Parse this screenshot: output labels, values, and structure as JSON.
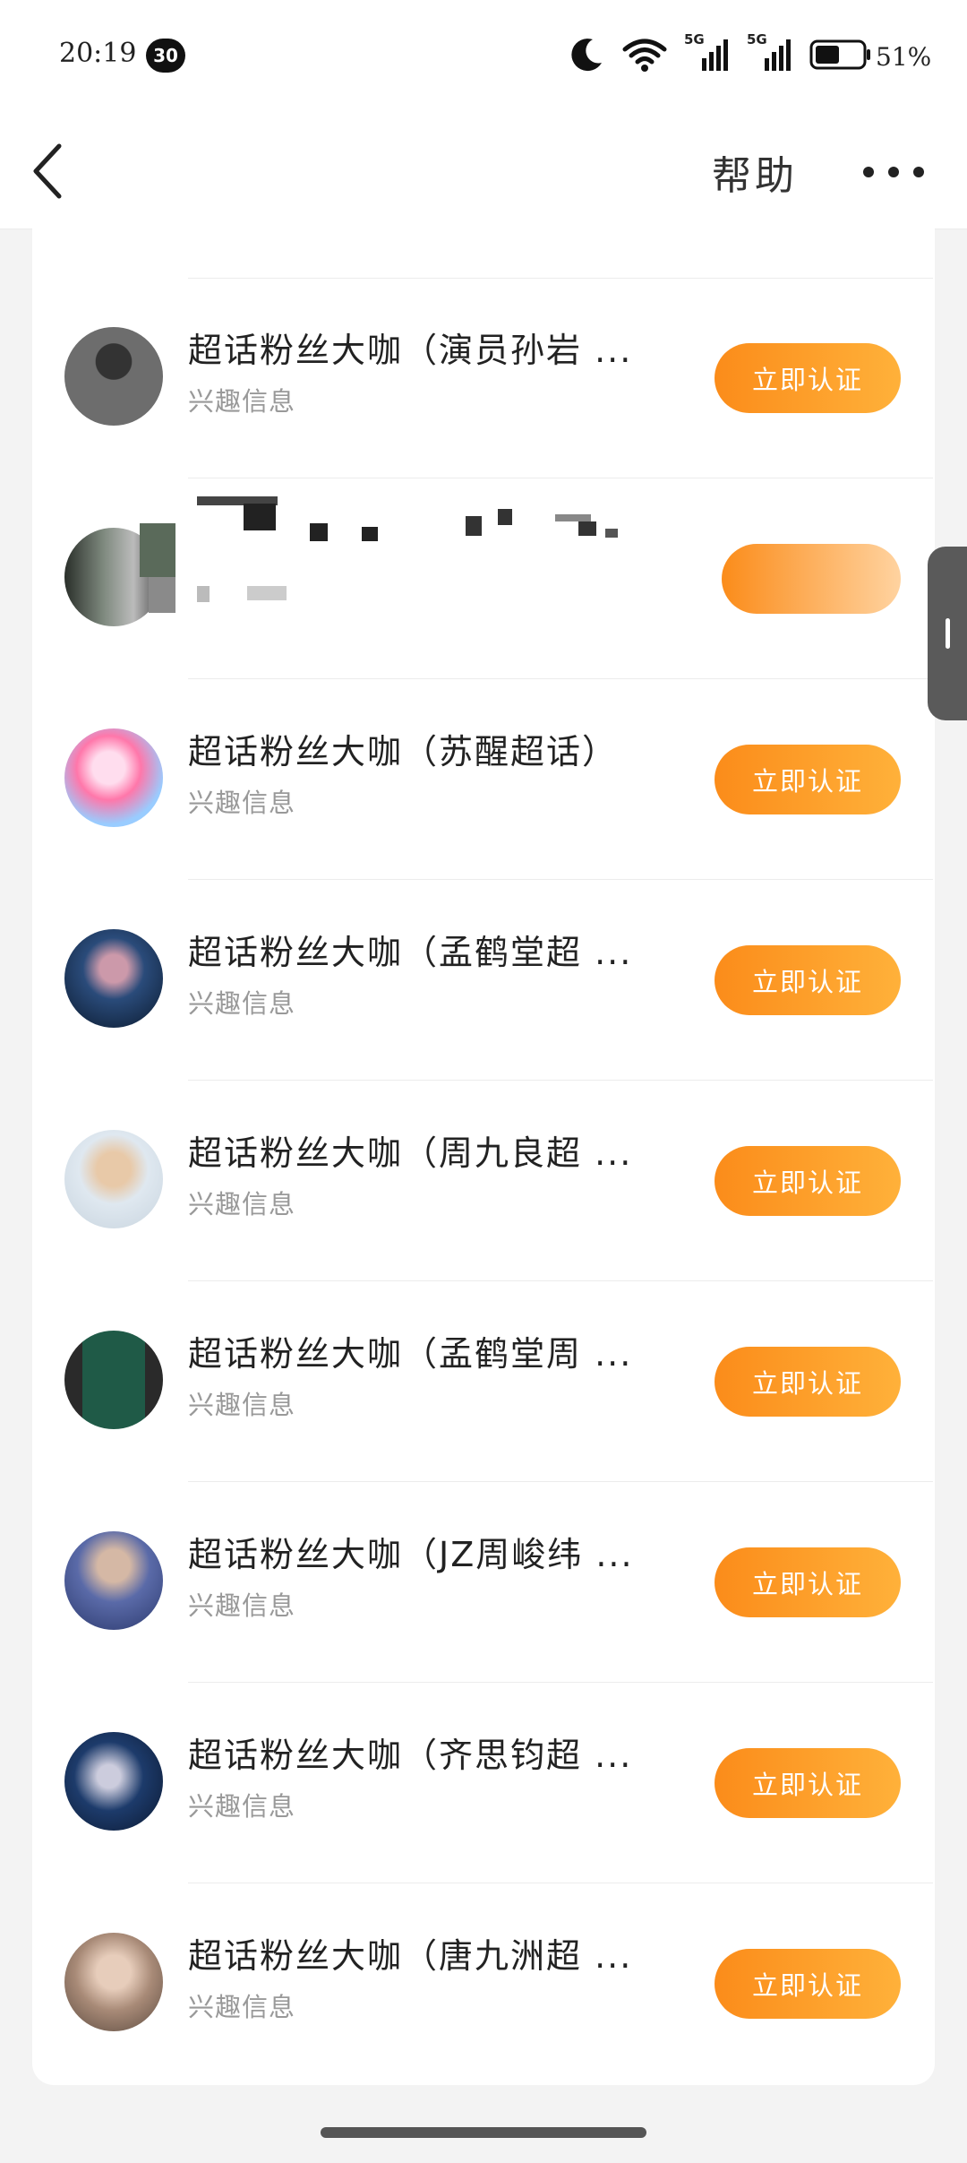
{
  "status_bar": {
    "time": "20:19",
    "notification_count": "30",
    "network_1": "5G",
    "network_2": "5G",
    "battery": "51%",
    "battery_level": 0.51,
    "icons": [
      "moon-icon",
      "wifi-icon",
      "signal-icon",
      "signal-icon",
      "battery-icon"
    ]
  },
  "nav": {
    "title": "帮助",
    "back_icon": "chevron-left-icon",
    "more_icon": "more-horizontal-icon"
  },
  "list": {
    "button_label": "立即认证",
    "items": [
      {
        "title": "超话粉丝大咖（演员孙岩 ...",
        "subtitle": "兴趣信息",
        "redacted": false
      },
      {
        "title": "",
        "subtitle": "",
        "redacted": true
      },
      {
        "title": "超话粉丝大咖（苏醒超话）",
        "subtitle": "兴趣信息",
        "redacted": false
      },
      {
        "title": "超话粉丝大咖（孟鹤堂超 ...",
        "subtitle": "兴趣信息",
        "redacted": false
      },
      {
        "title": "超话粉丝大咖（周九良超 ...",
        "subtitle": "兴趣信息",
        "redacted": false
      },
      {
        "title": "超话粉丝大咖（孟鹤堂周 ...",
        "subtitle": "兴趣信息",
        "redacted": false
      },
      {
        "title": "超话粉丝大咖（JZ周峻纬 ...",
        "subtitle": "兴趣信息",
        "redacted": false
      },
      {
        "title": "超话粉丝大咖（齐思钧超 ...",
        "subtitle": "兴趣信息",
        "redacted": false
      },
      {
        "title": "超话粉丝大咖（唐九洲超 ...",
        "subtitle": "兴趣信息",
        "redacted": false
      }
    ]
  },
  "colors": {
    "button_start": "#fb8c1a",
    "button_end": "#ffb13a",
    "background": "#f3f3f3"
  }
}
